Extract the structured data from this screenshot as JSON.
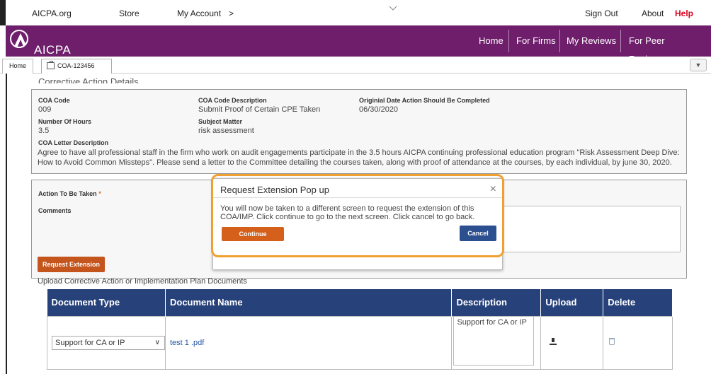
{
  "topbar": {
    "aicpa_org": "AICPA.org",
    "store": "Store",
    "my_account": "My Account",
    "my_account_arrow": ">",
    "sign_out": "Sign Out",
    "about": "About",
    "help": "Help"
  },
  "header": {
    "logo_text": "AICPA",
    "nav": [
      "Home",
      "For Firms",
      "My Reviews",
      "For Peer Reviewers"
    ]
  },
  "tabs": {
    "home": "Home",
    "coa": "COA-123456",
    "dropdown": "▼"
  },
  "details": {
    "section_title": "Corrective Action Details",
    "coa_code_label": "COA Code",
    "coa_code": "009",
    "coa_desc_label": "COA Code Description",
    "coa_desc": "Submit Proof of Certain CPE Taken",
    "orig_date_label": "Originial Date Action Should Be Completed",
    "orig_date": "06/30/2020",
    "hours_label": "Number Of Hours",
    "hours": "3.5",
    "subject_label": "Subject Matter",
    "subject": "risk assessment",
    "letter_label": "COA Letter Description",
    "letter": "Agree to have all professional staff in the firm who work on audit engagements participate in the 3.5 hours AICPA continuing professional education program \"Risk Assessment Deep Dive: How to Avoid Common Missteps\". Please send a letter to the Committee detailing the courses taken, along with proof of attendance at the courses, by each individual, by june 30, 2020."
  },
  "action": {
    "action_label": "Action To Be Taken",
    "required_mark": "*",
    "comments_label": "Comments",
    "request_extension": "Request Extension",
    "upload_title": "Upload Corrective Action or Implementation Plan Documents"
  },
  "table": {
    "headers": [
      "Document Type",
      "Document Name",
      "Description",
      "Upload",
      "Delete"
    ],
    "rows": [
      {
        "type": "Support for CA or IP",
        "name": "test 1 .pdf",
        "description": "Support for CA or IP"
      }
    ]
  },
  "modal": {
    "title": "Request Extension Pop up",
    "close": "×",
    "body": "You will now be taken to a different screen to request the extension of this COA/IMP. Click continue to go to the next screen. Click cancel to go back.",
    "continue": "Continue",
    "cancel": "Cancel"
  },
  "colors": {
    "header_purple": "#6f1e6c",
    "table_header_blue": "#27417a",
    "orange_button": "#d4601c",
    "modal_highlight": "#f0a030",
    "help_red": "#d6001c"
  }
}
